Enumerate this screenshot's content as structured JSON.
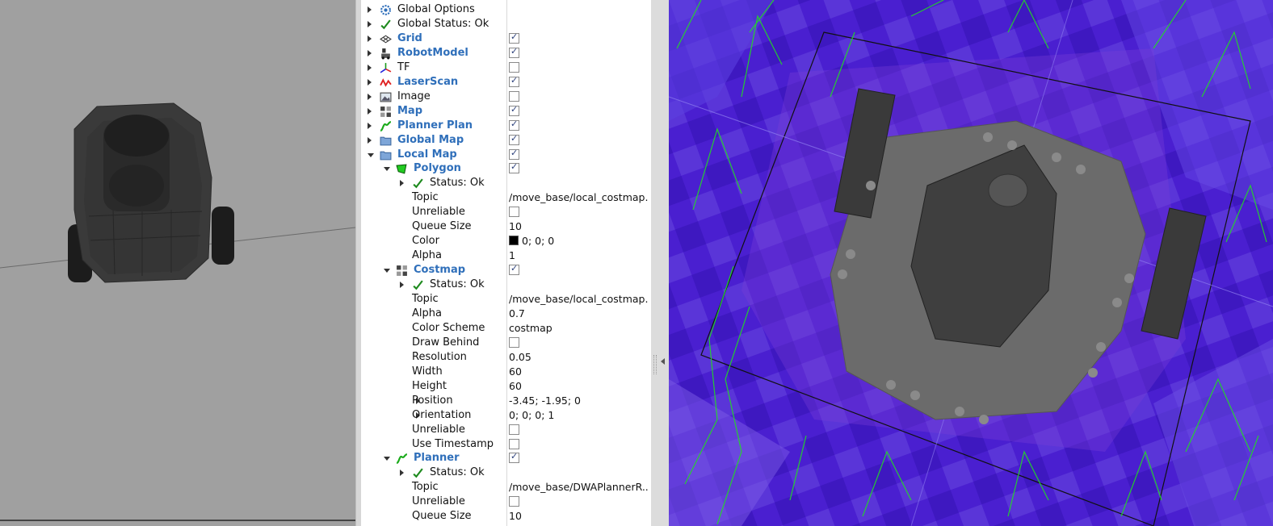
{
  "tree": {
    "rows": [
      {
        "label": "Global Options",
        "icon": "gear-icon",
        "arrow": "collapsed",
        "indent": 0,
        "style": "plain"
      },
      {
        "label": "Global Status: Ok",
        "icon": "check-icon",
        "arrow": "collapsed",
        "indent": 0,
        "style": "plain"
      },
      {
        "label": "Grid",
        "icon": "grid-icon",
        "arrow": "collapsed",
        "indent": 0,
        "style": "display",
        "checkbox": true
      },
      {
        "label": "RobotModel",
        "icon": "robot-icon",
        "arrow": "collapsed",
        "indent": 0,
        "style": "display",
        "checkbox": true
      },
      {
        "label": "TF",
        "icon": "axes-icon",
        "arrow": "collapsed",
        "indent": 0,
        "style": "plain",
        "checkbox": false
      },
      {
        "label": "LaserScan",
        "icon": "laser-icon",
        "arrow": "collapsed",
        "indent": 0,
        "style": "display",
        "checkbox": true
      },
      {
        "label": "Image",
        "icon": "image-icon",
        "arrow": "collapsed",
        "indent": 0,
        "style": "plain",
        "checkbox": false
      },
      {
        "label": "Map",
        "icon": "map-icon",
        "arrow": "collapsed",
        "indent": 0,
        "style": "display",
        "checkbox": true
      },
      {
        "label": "Planner Plan",
        "icon": "path-icon",
        "arrow": "collapsed",
        "indent": 0,
        "style": "display",
        "checkbox": true
      },
      {
        "label": "Global Map",
        "icon": "folder-icon",
        "arrow": "collapsed",
        "indent": 0,
        "style": "display",
        "checkbox": true
      },
      {
        "label": "Local Map",
        "icon": "folder-icon",
        "arrow": "expanded",
        "indent": 0,
        "style": "display",
        "checkbox": true
      },
      {
        "label": "Polygon",
        "icon": "polygon-icon",
        "arrow": "expanded",
        "indent": 1,
        "style": "display",
        "checkbox": true
      },
      {
        "label": "Status: Ok",
        "icon": "check-icon",
        "arrow": "collapsed",
        "indent": 2,
        "style": "plain"
      },
      {
        "label": "Topic",
        "indent": 3,
        "style": "plain",
        "value": "/move_base/local_costmap..."
      },
      {
        "label": "Unreliable",
        "indent": 3,
        "style": "plain",
        "checkbox": false
      },
      {
        "label": "Queue Size",
        "indent": 3,
        "style": "plain",
        "value": "10"
      },
      {
        "label": "Color",
        "indent": 3,
        "style": "plain",
        "value": "0; 0; 0",
        "swatch": "#000000"
      },
      {
        "label": "Alpha",
        "indent": 3,
        "style": "plain",
        "value": "1"
      },
      {
        "label": "Costmap",
        "icon": "map-icon",
        "arrow": "expanded",
        "indent": 1,
        "style": "display",
        "checkbox": true
      },
      {
        "label": "Status: Ok",
        "icon": "check-icon",
        "arrow": "collapsed",
        "indent": 2,
        "style": "plain"
      },
      {
        "label": "Topic",
        "indent": 3,
        "style": "plain",
        "value": "/move_base/local_costmap..."
      },
      {
        "label": "Alpha",
        "indent": 3,
        "style": "plain",
        "value": "0.7"
      },
      {
        "label": "Color Scheme",
        "indent": 3,
        "style": "plain",
        "value": "costmap"
      },
      {
        "label": "Draw Behind",
        "indent": 3,
        "style": "plain",
        "checkbox": false
      },
      {
        "label": "Resolution",
        "indent": 3,
        "style": "plain",
        "value": "0.05"
      },
      {
        "label": "Width",
        "indent": 3,
        "style": "plain",
        "value": "60"
      },
      {
        "label": "Height",
        "indent": 3,
        "style": "plain",
        "value": "60"
      },
      {
        "label": "Position",
        "indent": 3,
        "arrow": "collapsed",
        "style": "plain",
        "value": "-3.45; -1.95; 0"
      },
      {
        "label": "Orientation",
        "indent": 3,
        "arrow": "collapsed",
        "style": "plain",
        "value": "0; 0; 0; 1"
      },
      {
        "label": "Unreliable",
        "indent": 3,
        "style": "plain",
        "checkbox": false
      },
      {
        "label": "Use Timestamp",
        "indent": 3,
        "style": "plain",
        "checkbox": false
      },
      {
        "label": "Planner",
        "icon": "path-icon",
        "arrow": "expanded",
        "indent": 1,
        "style": "display",
        "checkbox": true
      },
      {
        "label": "Status: Ok",
        "icon": "check-icon",
        "arrow": "collapsed",
        "indent": 2,
        "style": "plain"
      },
      {
        "label": "Topic",
        "indent": 3,
        "style": "plain",
        "value": "/move_base/DWAPlannerR..."
      },
      {
        "label": "Unreliable",
        "indent": 3,
        "style": "plain",
        "checkbox": false
      },
      {
        "label": "Queue Size",
        "indent": 3,
        "style": "plain",
        "value": "10"
      }
    ]
  },
  "colors": {
    "display_label": "#2f6fba",
    "check_green": "#1e8a1e",
    "costmap_bg": "#4a1fd0",
    "viewport_gray": "#a0a0a0",
    "path_green": "#22dd22"
  }
}
